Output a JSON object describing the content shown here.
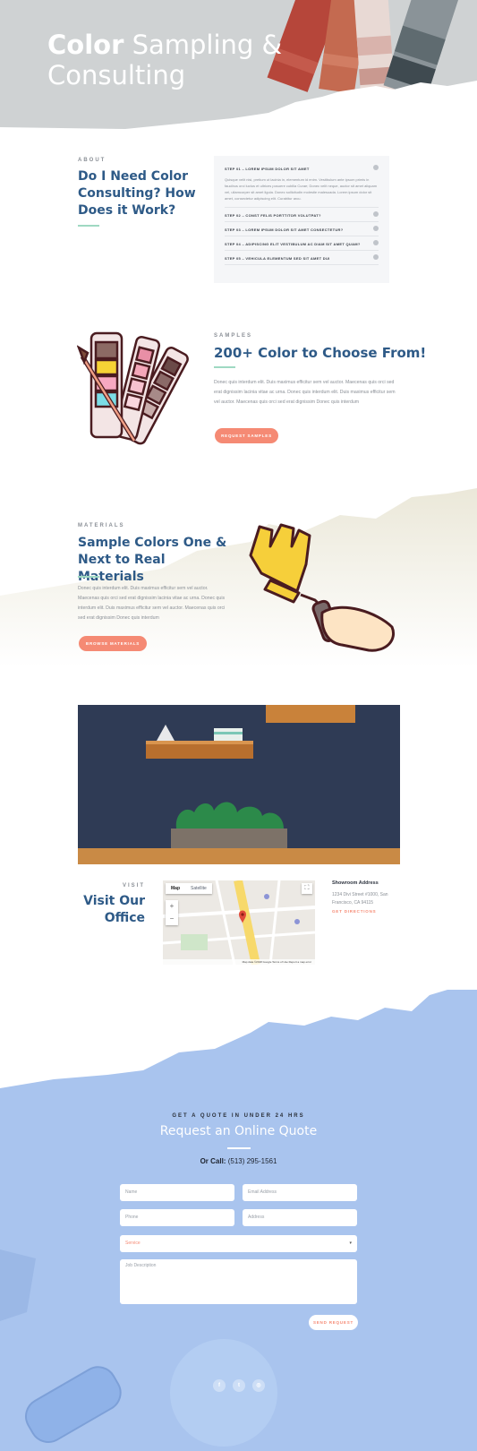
{
  "hero": {
    "title_bold": "Color",
    "title_rest": " Sampling &",
    "title_line2": "Consulting"
  },
  "about": {
    "eyebrow": "ABOUT",
    "title": "Do I Need Color Consulting? How Does it Work?",
    "accordion": [
      {
        "title": "STEP 01 – LOREM IPSUM DOLOR SIT AMET",
        "body": "Quisque velit nisi, pretium ut lacinia in, elementum id enim. Vestibulum ante ipsum primis in faucibus orci luctus et ultrices posuere cubilia Curae; Donec velit neque, auctor sit amet aliquam vel, ullamcorper sit amet ligula. Donec sollicitudin molestie malesuada. Lorem ipsum dolor sit amet, consectetur adipiscing elit. Curabitur arcu."
      },
      {
        "title": "STEP 02 – CONST FELIS PORTTITOR VOLUTPAT?"
      },
      {
        "title": "STEP 03 – LOREM IPSUM DOLOR SIT AMET CONSECTETUR?"
      },
      {
        "title": "STEP 04 – ADIPISCING ELIT VESTIBULUM AC DIAM SIT AMET QUAM?"
      },
      {
        "title": "STEP 05 – VEHICULA ELEMENTUM SED SIT AMET DUI"
      }
    ]
  },
  "samples": {
    "eyebrow": "SAMPLES",
    "title": "200+ Color to Choose From!",
    "body": "Donec quis interdum elit. Duis maximus efficitur sem vel auctor. Maecenas quis orci sed erat dignissim lacinia vitae ac urna. Donec quis interdum elit. Duis maximus efficitur sem vel auctor. Maecenas quis orci sed erat dignissim Donec quis interdum",
    "button": "REQUEST SAMPLES"
  },
  "materials": {
    "eyebrow": "MATERIALS",
    "title": "Sample Colors One & Next to Real Materials",
    "body": "Donec quis interdum elit. Duis maximus efficitur sem vel auctor. Maecenas quis orci sed erat dignissim lacinia vitae ac urna. Donec quis interdum elit. Duis maximus efficitur sem vel auctor. Maecenas quis orci sed erat dignissim Donec quis interdum",
    "button": "BROWSE MATERIALS"
  },
  "visit": {
    "eyebrow": "VISIT",
    "title": "Visit Our Office",
    "map": {
      "tab_map": "Map",
      "tab_satellite": "Satellite",
      "footer": "Map data ©2018 Google   Terms of Use   Report a map error"
    },
    "address_title": "Showroom Address",
    "address_body": "1234 Divi Street #1000, San Francisco, CA 94115",
    "directions": "GET DIRECTIONS"
  },
  "quote": {
    "eyebrow": "GET A QUOTE IN UNDER 24 HRS",
    "title": "Request an Online Quote",
    "call_label": "Or Call:",
    "call_number": " (513) 295-1561",
    "name_ph": "Name",
    "email_ph": "Email Address",
    "phone_ph": "Phone",
    "address_ph": "Address",
    "service_ph": "Service",
    "job_ph": "Job Description",
    "send": "SEND REQUEST"
  },
  "social": [
    "f",
    "t",
    "◎"
  ],
  "colors": {
    "accent": "#f58a74",
    "heading": "#2e5a87",
    "quote_bg": "#a9c4ee"
  }
}
